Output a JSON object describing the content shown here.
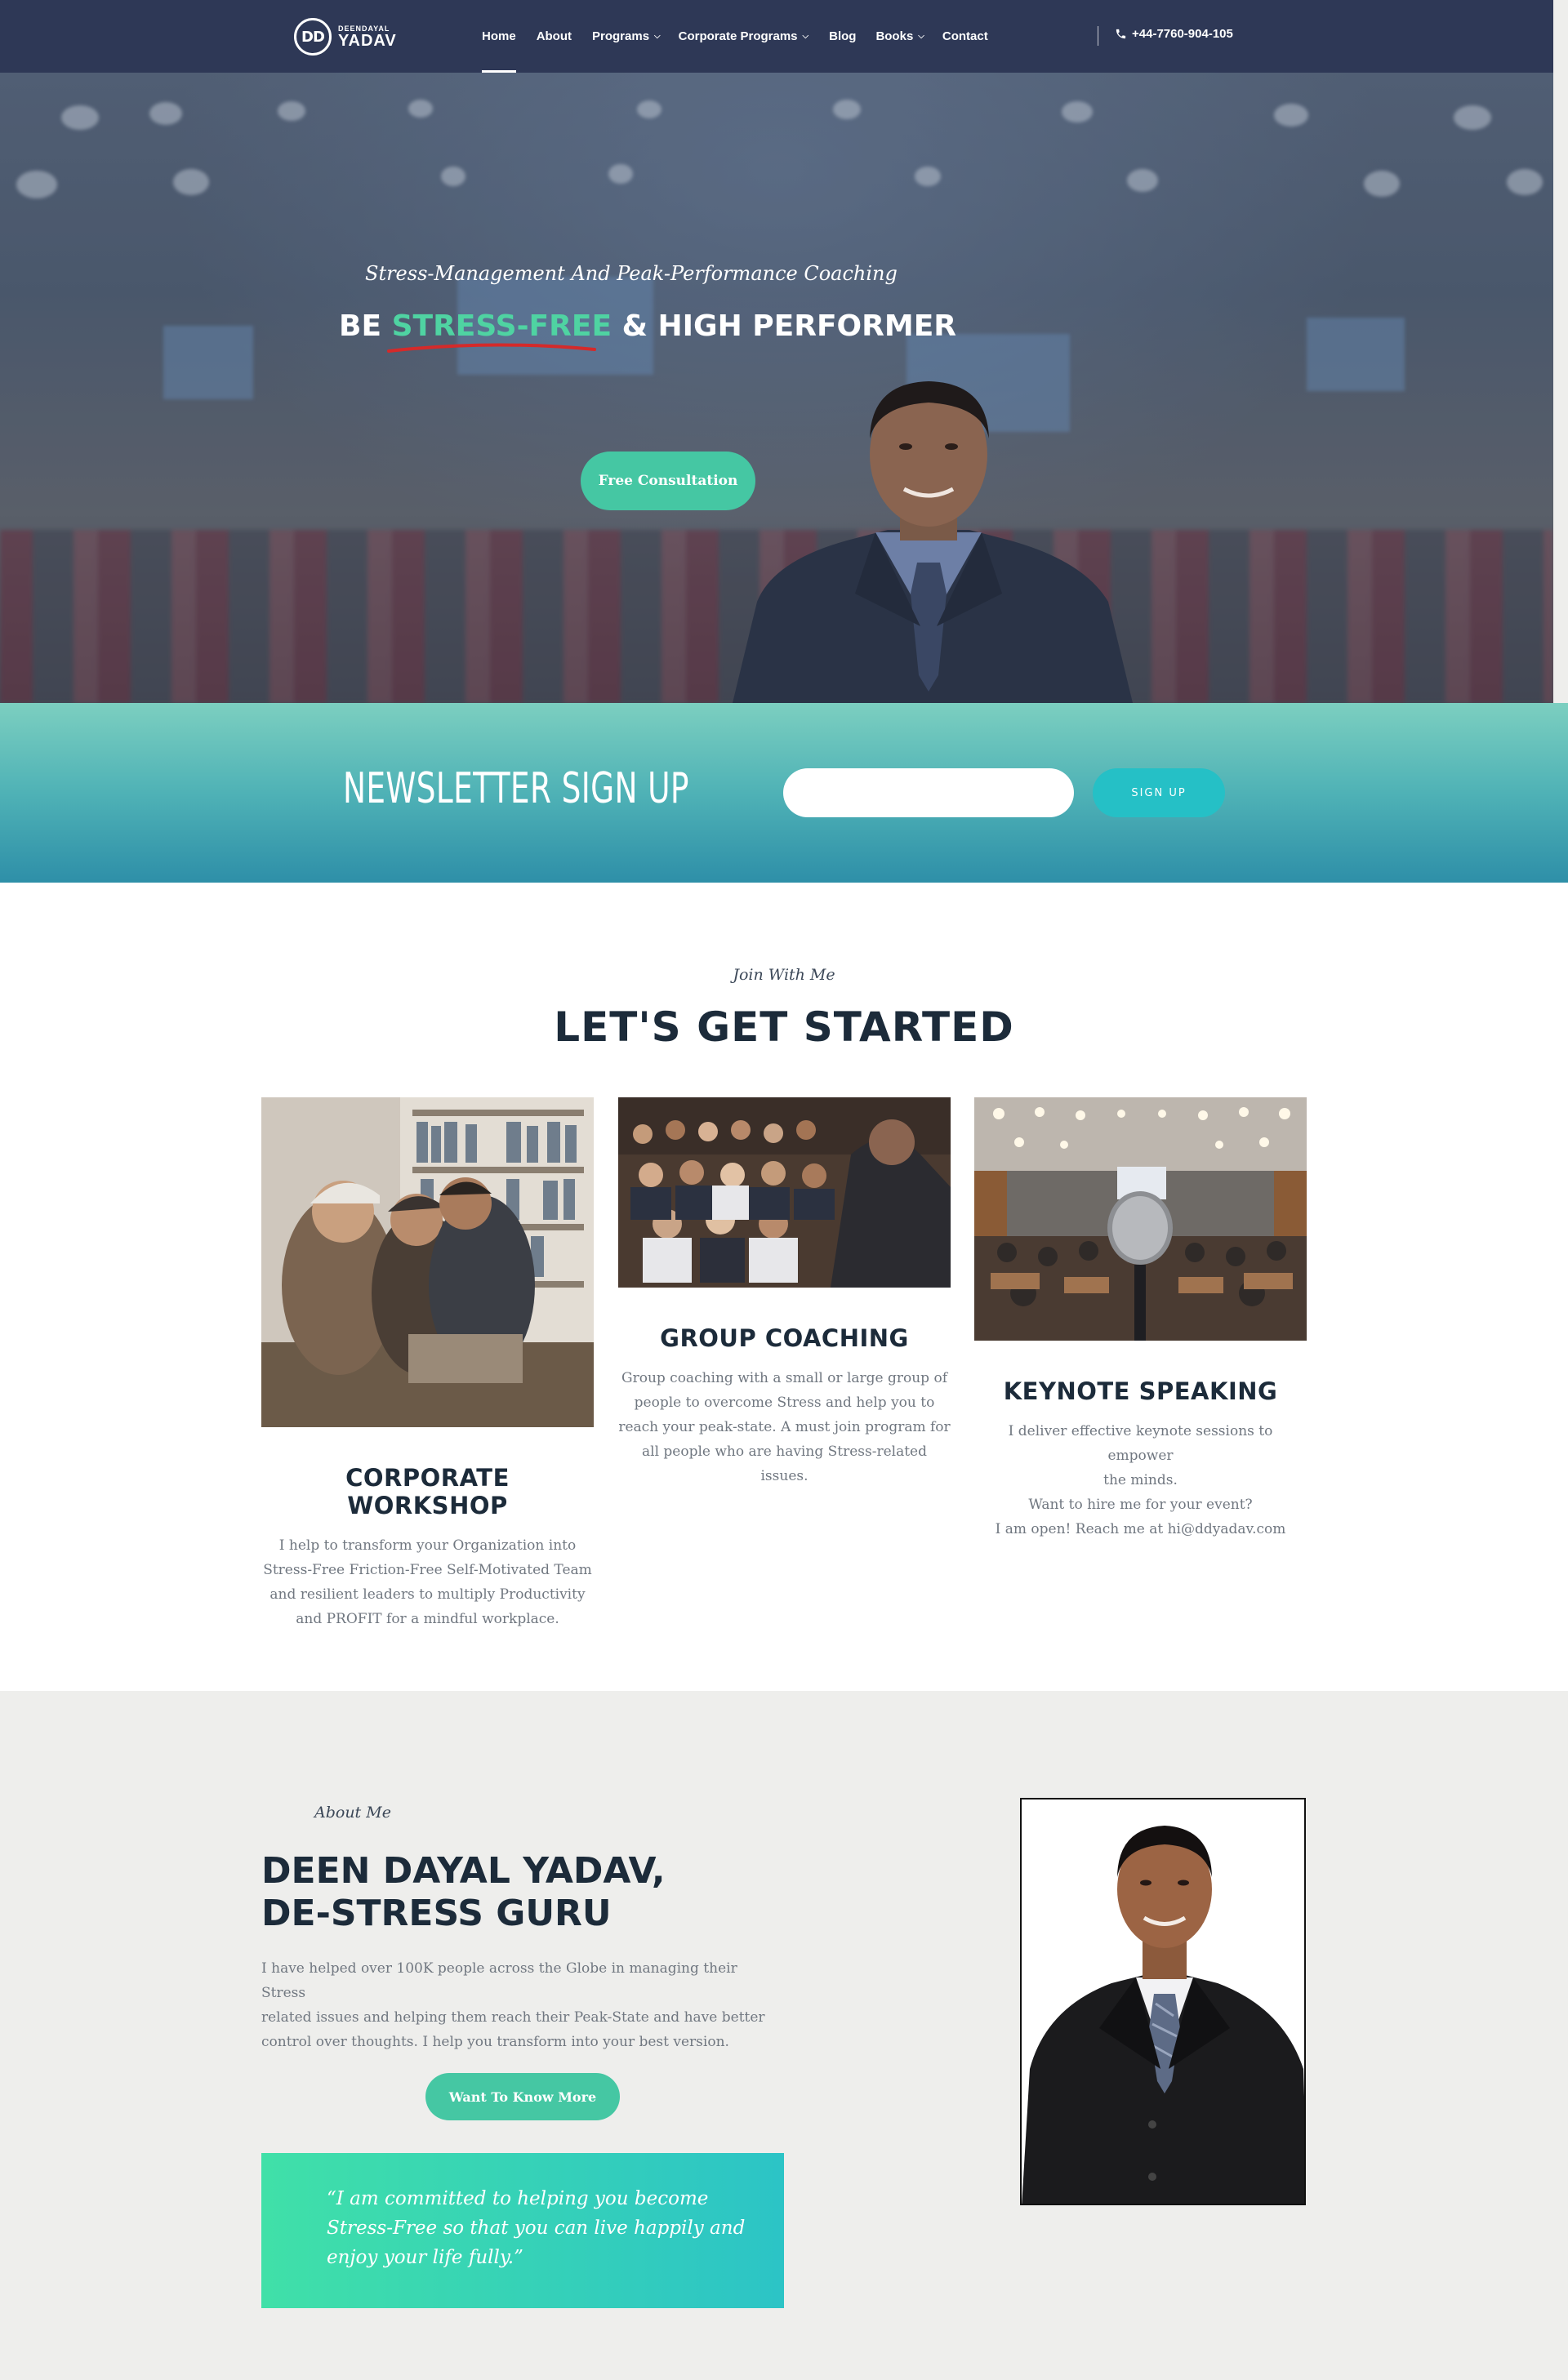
{
  "nav": {
    "logo_initials": "DD",
    "logo_small": "DEENDAYAL",
    "logo_big": "YADAV",
    "items": [
      {
        "label": "Home",
        "dropdown": false,
        "active": true
      },
      {
        "label": "About",
        "dropdown": false,
        "active": false
      },
      {
        "label": "Programs",
        "dropdown": true,
        "active": false
      },
      {
        "label": "Corporate Programs",
        "dropdown": true,
        "active": false
      },
      {
        "label": "Blog",
        "dropdown": false,
        "active": false
      },
      {
        "label": "Books",
        "dropdown": true,
        "active": false
      },
      {
        "label": "Contact",
        "dropdown": false,
        "active": false
      }
    ],
    "phone": "+44-7760-904-105",
    "phone_icon": "phone-icon"
  },
  "hero": {
    "tagline": "Stress-Management And Peak-Performance Coaching",
    "title_prefix": "BE ",
    "title_highlight": "STRESS-FREE",
    "title_suffix": " & HIGH PERFORMER",
    "button": "Free Consultation"
  },
  "newsletter": {
    "title": "NEWSLETTER SIGN UP",
    "input_value": "",
    "button": "SIGN UP"
  },
  "started": {
    "kicker": "Join With Me",
    "title": "LET'S GET STARTED",
    "cards": [
      {
        "title": "CORPORATE WORKSHOP",
        "lines": [
          "I help to transform your Organization into",
          "Stress-Free Friction-Free Self-Motivated Team",
          "and resilient leaders to multiply Productivity",
          "and PROFIT for a mindful workplace."
        ]
      },
      {
        "title": "GROUP COACHING",
        "lines": [
          "Group coaching with a small or large group of",
          "people to overcome Stress and help you to",
          "reach your peak-state. A must join program for",
          "all people who are having Stress-related issues."
        ]
      },
      {
        "title": "KEYNOTE SPEAKING",
        "lines": [
          "I deliver effective keynote sessions to empower",
          "the minds.",
          "Want to hire me for your event?",
          "I am open! Reach me at hi@ddyadav.com"
        ]
      }
    ]
  },
  "about": {
    "kicker": "About Me",
    "title_line1": "DEEN DAYAL YADAV,",
    "title_line2": "DE-STRESS GURU",
    "text_lines": [
      "I have helped over 100K people across the Globe in managing their Stress",
      "related issues and helping them reach their Peak-State and have better",
      "control over thoughts. I help you transform into your best version."
    ],
    "button": "Want To Know More",
    "quote_lines": [
      "“I am committed to helping you become",
      "Stress-Free so that you can live happily and",
      "enjoy your life fully.”"
    ]
  },
  "colors": {
    "nav_bg": "#2e3856",
    "accent_green": "#45c7a3",
    "highlight": "#4fd3a2",
    "signup_button": "#25c0c6",
    "heading": "#1c2b3a",
    "underline_red": "#d42a2a"
  }
}
